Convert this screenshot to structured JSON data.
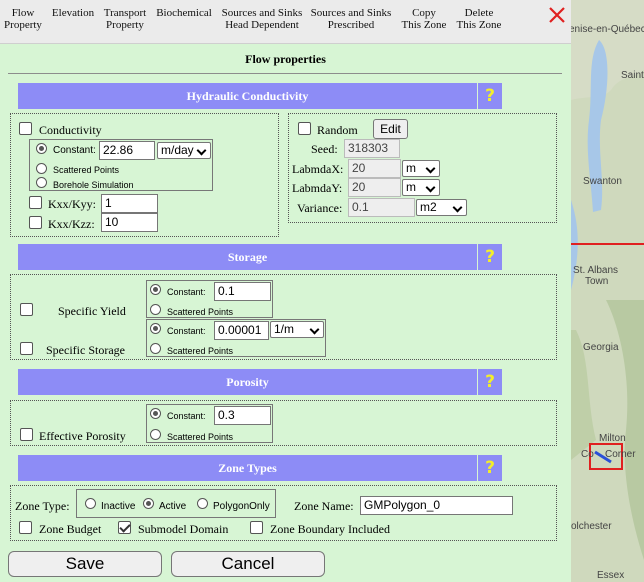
{
  "toolbar": {
    "items": [
      {
        "line1": "Flow",
        "line2": "Property"
      },
      {
        "line1": "Elevation",
        "line2": ""
      },
      {
        "line1": "Transport",
        "line2": "Property"
      },
      {
        "line1": "Biochemical",
        "line2": ""
      },
      {
        "line1": "Sources and Sinks",
        "line2": "Head Dependent"
      },
      {
        "line1": "Sources and Sinks",
        "line2": "Prescribed"
      },
      {
        "line1": "Copy",
        "line2": "This Zone"
      },
      {
        "line1": "Delete",
        "line2": "This Zone"
      }
    ],
    "close_icon": "close-x-icon",
    "close_color": "#e02020"
  },
  "page_title": "Flow properties",
  "help_label": "?",
  "colors": {
    "section_bar": "#8d8cf6",
    "help_mark": "#f3ee2b",
    "panel_bg": "#d7f5d4"
  },
  "hydraulic": {
    "title": "Hydraulic Conductivity",
    "conductivity_label": "Conductivity",
    "constant_label": "Constant:",
    "constant_value": "22.86",
    "unit": "m/day",
    "scattered_label": "Scattered Points",
    "borehole_label": "Borehole Simulation",
    "kxx_kyy_label": "Kxx/Kyy:",
    "kxx_kyy_value": "1",
    "kxx_kzz_label": "Kxx/Kzz:",
    "kxx_kzz_value": "10",
    "random_label": "Random",
    "edit_label": "Edit",
    "seed_label": "Seed:",
    "seed_value": "318303",
    "lambdax_label": "LabmdaX:",
    "lambdax_value": "20",
    "lambdax_unit": "m",
    "lambday_label": "LabmdaY:",
    "lambday_value": "20",
    "lambday_unit": "m",
    "variance_label": "Variance:",
    "variance_value": "0.1",
    "variance_unit": "m2"
  },
  "storage": {
    "title": "Storage",
    "specific_yield_label": "Specific Yield",
    "sy_constant_label": "Constant:",
    "sy_value": "0.1",
    "sy_scattered_label": "Scattered Points",
    "specific_storage_label": "Specific Storage",
    "ss_constant_label": "Constant:",
    "ss_value": "0.00001",
    "ss_unit": "1/m",
    "ss_scattered_label": "Scattered Points"
  },
  "porosity": {
    "title": "Porosity",
    "effective_label": "Effective Porosity",
    "constant_label": "Constant:",
    "value": "0.3",
    "scattered_label": "Scattered Points"
  },
  "zone": {
    "title": "Zone Types",
    "zone_type_label": "Zone Type:",
    "inactive_label": "Inactive",
    "active_label": "Active",
    "polygon_only_label": "PolygonOnly",
    "zone_name_label": "Zone Name:",
    "zone_name_value": "GMPolygon_0",
    "zone_budget_label": "Zone Budget",
    "submodel_label": "Submodel Domain",
    "boundary_label": "Zone Boundary Included"
  },
  "buttons": {
    "save": "Save",
    "cancel": "Cancel"
  },
  "map": {
    "labels": [
      "enise-en-Québec",
      "Saint",
      "Swanton",
      "St. Albans",
      "Town",
      "Georgia",
      "Milton",
      "Co",
      "Corner",
      "olchester",
      "Essex"
    ],
    "boundary_color": "#e02020",
    "water_color": "#a7c7e8"
  }
}
